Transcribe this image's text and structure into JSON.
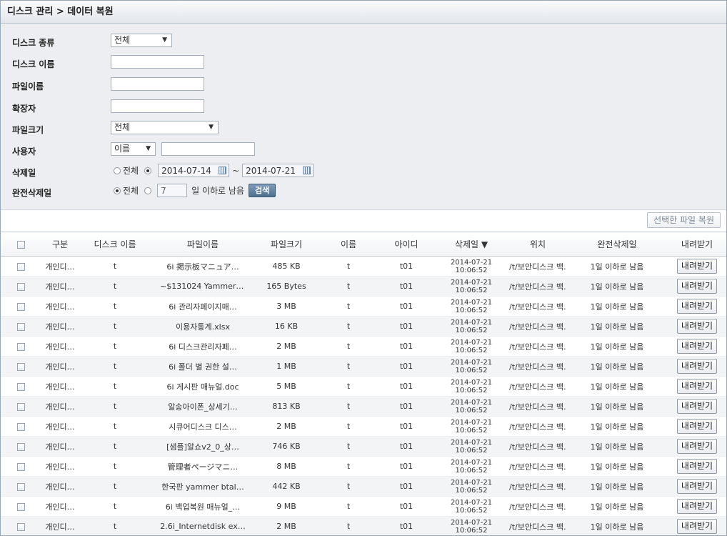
{
  "breadcrumb": "디스크 관리 > 데이터 복원",
  "form": {
    "disk_type": {
      "label": "디스크 종류",
      "selected": "전체"
    },
    "disk_name": {
      "label": "디스크 이름",
      "value": ""
    },
    "file_name": {
      "label": "파일이름",
      "value": ""
    },
    "extension": {
      "label": "확장자",
      "value": ""
    },
    "file_size": {
      "label": "파일크기",
      "selected": "전체"
    },
    "user": {
      "label": "사용자",
      "selected": "이름",
      "value": ""
    },
    "deleted_date": {
      "label": "삭제일",
      "all_label": "전체",
      "from": "2014-07-14",
      "sep": "~",
      "to": "2014-07-21"
    },
    "perm_delete": {
      "label": "완전삭제일",
      "all_label": "전체",
      "days": "7",
      "suffix": "일 이하로 남음",
      "search_label": "검색"
    }
  },
  "toolbar": {
    "restore_label": "선택한 파일 복원"
  },
  "table": {
    "headers": [
      "구분",
      "디스크 이름",
      "파일이름",
      "파일크기",
      "이름",
      "아이디",
      "삭제일 ▼",
      "위치",
      "완전삭제일",
      "내려받기"
    ],
    "rows": [
      {
        "type": "개인디…",
        "disk": "t",
        "file": "6i 掲示板マニュア…",
        "size": "485 KB",
        "name": "t",
        "id": "t01",
        "date": "2014-07-21",
        "time": "10:06:52",
        "loc": "/t/보안디스크 백…",
        "perm": "1일 이하로 남음",
        "dl": "내려받기"
      },
      {
        "type": "개인디…",
        "disk": "t",
        "file": "~$131024 Yammer …",
        "size": "165 Bytes",
        "name": "t",
        "id": "t01",
        "date": "2014-07-21",
        "time": "10:06:52",
        "loc": "/t/보안디스크 백…",
        "perm": "1일 이하로 남음",
        "dl": "내려받기"
      },
      {
        "type": "개인디…",
        "disk": "t",
        "file": "6i 관리자페이지매…",
        "size": "3 MB",
        "name": "t",
        "id": "t01",
        "date": "2014-07-21",
        "time": "10:06:52",
        "loc": "/t/보안디스크 백…",
        "perm": "1일 이하로 남음",
        "dl": "내려받기"
      },
      {
        "type": "개인디…",
        "disk": "t",
        "file": "이용자통계.xlsx",
        "size": "16 KB",
        "name": "t",
        "id": "t01",
        "date": "2014-07-21",
        "time": "10:06:52",
        "loc": "/t/보안디스크 백…",
        "perm": "1일 이하로 남음",
        "dl": "내려받기"
      },
      {
        "type": "개인디…",
        "disk": "t",
        "file": "6i 디스크관리자페…",
        "size": "2 MB",
        "name": "t",
        "id": "t01",
        "date": "2014-07-21",
        "time": "10:06:52",
        "loc": "/t/보안디스크 백…",
        "perm": "1일 이하로 남음",
        "dl": "내려받기"
      },
      {
        "type": "개인디…",
        "disk": "t",
        "file": "6i 폴더 별 권한 설…",
        "size": "1 MB",
        "name": "t",
        "id": "t01",
        "date": "2014-07-21",
        "time": "10:06:52",
        "loc": "/t/보안디스크 백…",
        "perm": "1일 이하로 남음",
        "dl": "내려받기"
      },
      {
        "type": "개인디…",
        "disk": "t",
        "file": "6i 게시판 매뉴얼.doc",
        "size": "5 MB",
        "name": "t",
        "id": "t01",
        "date": "2014-07-21",
        "time": "10:06:52",
        "loc": "/t/보안디스크 백…",
        "perm": "1일 이하로 남음",
        "dl": "내려받기"
      },
      {
        "type": "개인디…",
        "disk": "t",
        "file": "알송아이폰_상세기…",
        "size": "813 KB",
        "name": "t",
        "id": "t01",
        "date": "2014-07-21",
        "time": "10:06:52",
        "loc": "/t/보안디스크 백…",
        "perm": "1일 이하로 남음",
        "dl": "내려받기"
      },
      {
        "type": "개인디…",
        "disk": "t",
        "file": "시큐어디스크 디스…",
        "size": "2 MB",
        "name": "t",
        "id": "t01",
        "date": "2014-07-21",
        "time": "10:06:52",
        "loc": "/t/보안디스크 백…",
        "perm": "1일 이하로 남음",
        "dl": "내려받기"
      },
      {
        "type": "개인디…",
        "disk": "t",
        "file": "[샘플]알쇼v2_0_상…",
        "size": "746 KB",
        "name": "t",
        "id": "t01",
        "date": "2014-07-21",
        "time": "10:06:52",
        "loc": "/t/보안디스크 백…",
        "perm": "1일 이하로 남음",
        "dl": "내려받기"
      },
      {
        "type": "개인디…",
        "disk": "t",
        "file": "管理者ページマニ…",
        "size": "8 MB",
        "name": "t",
        "id": "t01",
        "date": "2014-07-21",
        "time": "10:06:52",
        "loc": "/t/보안디스크 백…",
        "perm": "1일 이하로 남음",
        "dl": "내려받기"
      },
      {
        "type": "개인디…",
        "disk": "t",
        "file": "한국판 yammer btal…",
        "size": "442 KB",
        "name": "t",
        "id": "t01",
        "date": "2014-07-21",
        "time": "10:06:52",
        "loc": "/t/보안디스크 백…",
        "perm": "1일 이하로 남음",
        "dl": "내려받기"
      },
      {
        "type": "개인디…",
        "disk": "t",
        "file": "6i 백업복원 매뉴얼_…",
        "size": "9 MB",
        "name": "t",
        "id": "t01",
        "date": "2014-07-21",
        "time": "10:06:52",
        "loc": "/t/보안디스크 백…",
        "perm": "1일 이하로 남음",
        "dl": "내려받기"
      },
      {
        "type": "개인디…",
        "disk": "t",
        "file": "2.6i_Internetdisk ex…",
        "size": "2 MB",
        "name": "t",
        "id": "t01",
        "date": "2014-07-21",
        "time": "10:06:52",
        "loc": "/t/보안디스크 백…",
        "perm": "1일 이하로 남음",
        "dl": "내려받기"
      }
    ]
  }
}
